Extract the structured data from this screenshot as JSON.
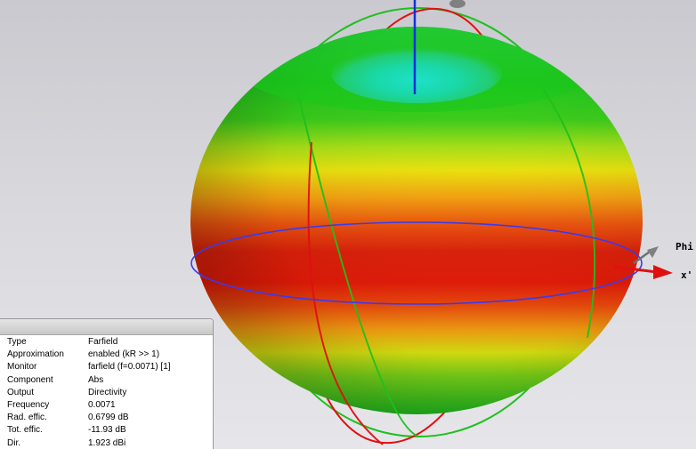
{
  "scene": {
    "axes": {
      "phi_label": "Phi",
      "x_label": "x'"
    },
    "colors": {
      "background_top": "#c9c9cf",
      "background_bottom": "#e6e6ea",
      "ring_red": "#e01010",
      "ring_green": "#1ec01e",
      "ring_blue": "#3a3af0",
      "axis_z": "#1030e0",
      "axis_x": "#e01010"
    }
  },
  "info_panel": {
    "rows": [
      {
        "key": "Type",
        "value": "Farfield"
      },
      {
        "key": "Approximation",
        "value": "enabled (kR >> 1)"
      },
      {
        "key": "Monitor",
        "value": "farfield (f=0.0071) [1]"
      },
      {
        "key": "Component",
        "value": "Abs"
      },
      {
        "key": "Output",
        "value": "Directivity"
      },
      {
        "key": "Frequency",
        "value": "0.0071"
      },
      {
        "key": "Rad. effic.",
        "value": "0.6799 dB"
      },
      {
        "key": "Tot. effic.",
        "value": "-11.93 dB"
      },
      {
        "key": "Dir.",
        "value": "1.923 dBi"
      }
    ]
  }
}
